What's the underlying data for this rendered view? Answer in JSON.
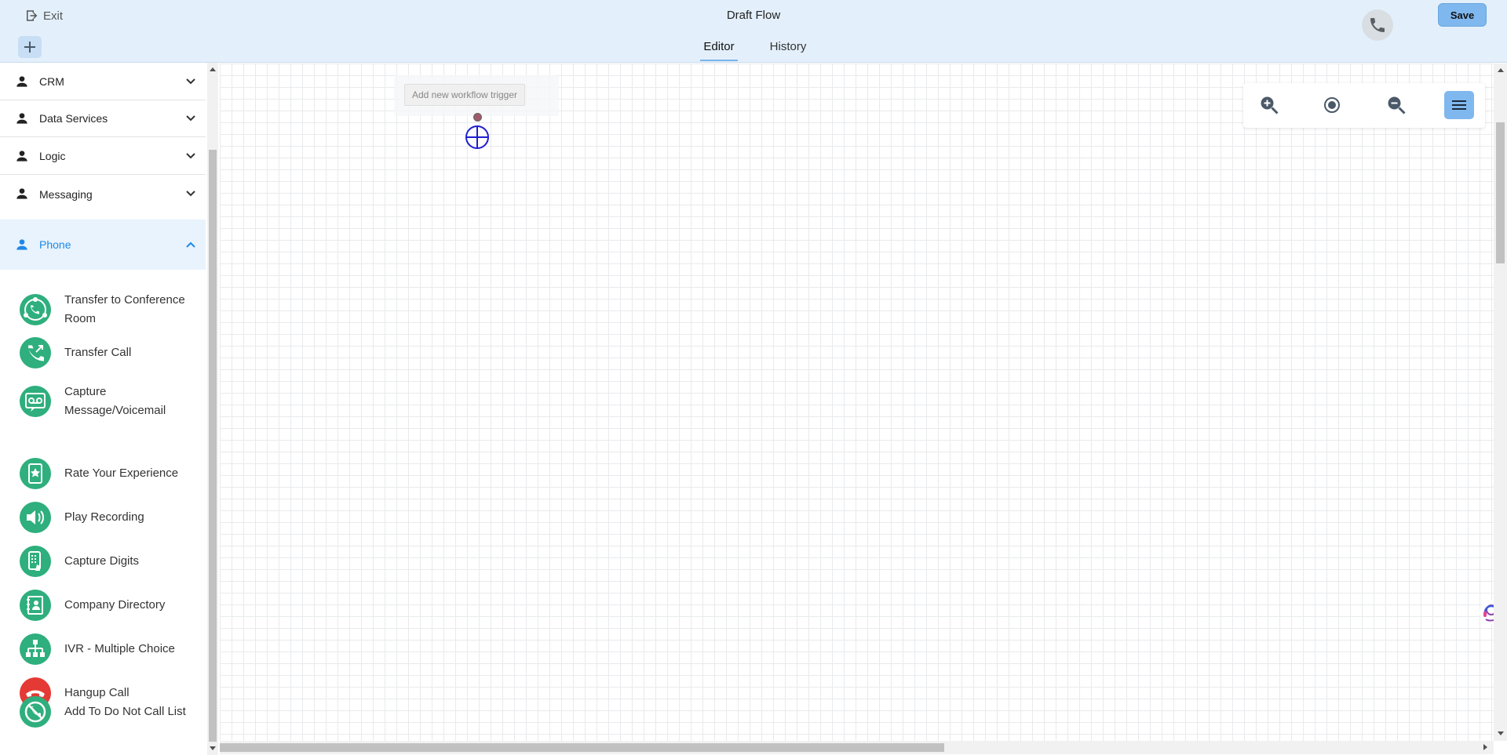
{
  "header": {
    "exit_label": "Exit",
    "title": "Draft Flow",
    "save_label": "Save",
    "tabs": [
      {
        "label": "Editor",
        "active": true
      },
      {
        "label": "History",
        "active": false
      }
    ],
    "icons": {
      "exit": "exit-icon",
      "add": "plus-icon",
      "phone": "phone-icon"
    }
  },
  "sidebar": {
    "categories": [
      {
        "label": "CRM",
        "expanded": false
      },
      {
        "label": "Data Services",
        "expanded": false
      },
      {
        "label": "Logic",
        "expanded": false
      },
      {
        "label": "Messaging",
        "expanded": false
      },
      {
        "label": "Phone",
        "expanded": true
      }
    ],
    "phone_items": [
      {
        "label": "Transfer to Conference Room",
        "icon": "conference-room-icon",
        "color": "#2eaf7d"
      },
      {
        "label": "Transfer Call",
        "icon": "transfer-call-icon",
        "color": "#2eaf7d"
      },
      {
        "label": "Capture Message/Voicemail",
        "icon": "voicemail-icon",
        "color": "#2eaf7d"
      },
      {
        "label": "Rate Your Experience",
        "icon": "rate-experience-icon",
        "color": "#2eaf7d"
      },
      {
        "label": "Play Recording",
        "icon": "speaker-icon",
        "color": "#2eaf7d"
      },
      {
        "label": "Capture Digits",
        "icon": "keypad-icon",
        "color": "#2eaf7d"
      },
      {
        "label": "Company Directory",
        "icon": "directory-icon",
        "color": "#2eaf7d"
      },
      {
        "label": "IVR - Multiple Choice",
        "icon": "ivr-tree-icon",
        "color": "#2eaf7d"
      },
      {
        "label": "Hangup Call",
        "icon": "hangup-icon",
        "color": "#e53935"
      },
      {
        "label": "Add To Do Not Call List",
        "icon": "do-not-call-icon",
        "color": "#2eaf7d"
      }
    ]
  },
  "canvas": {
    "trigger_label": "Add new workflow trigger",
    "zoom_controls": [
      "zoom-in-icon",
      "center-icon",
      "zoom-out-icon",
      "menu-icon"
    ]
  },
  "colors": {
    "header_bg": "#e3f0fc",
    "accent": "#7fb8ee",
    "active_category": "#1e88e5",
    "item_green": "#2eaf7d",
    "hangup_red": "#e53935"
  }
}
